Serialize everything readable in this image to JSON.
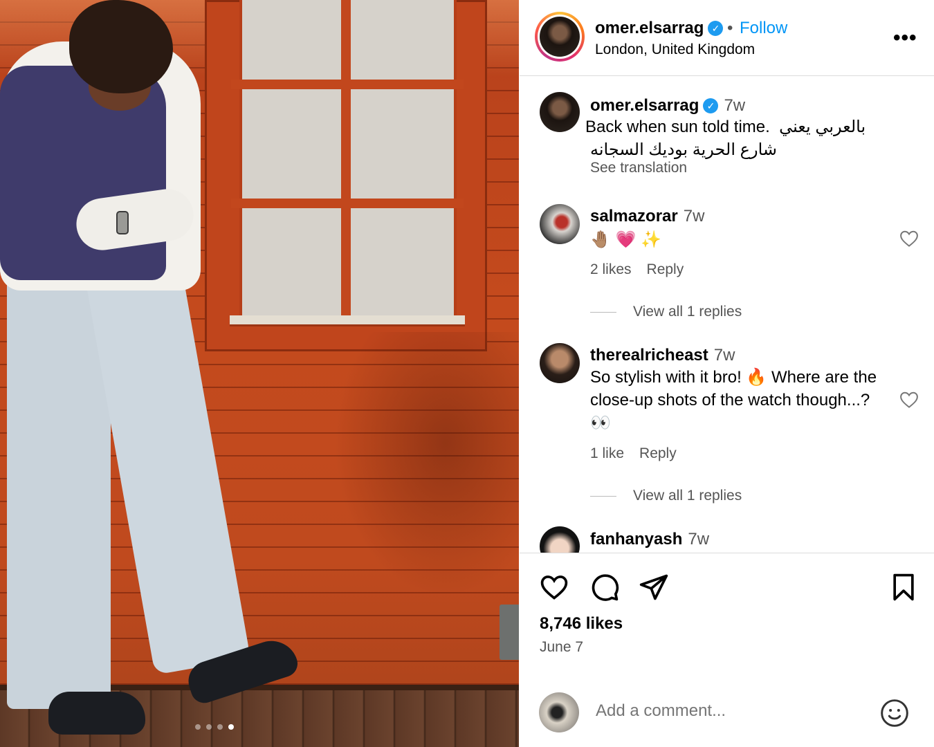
{
  "header": {
    "username": "omer.elsarrag",
    "verified_mark": "✓",
    "separator": "•",
    "follow_label": "Follow",
    "location": "London, United Kingdom",
    "more_label": "•••"
  },
  "caption": {
    "username": "omer.elsarrag",
    "time": "7w",
    "line1_en": "Back when sun told time.",
    "line1_ar": "بالعربي يعني",
    "line2_ar": "شارع الحرية بوديك السجانه",
    "see_translation": "See translation"
  },
  "comments": [
    {
      "username": "salmazorar",
      "time": "7w",
      "text": "🤚🏽 💗 ✨",
      "likes": "2 likes",
      "reply": "Reply",
      "view_replies": "View all 1 replies"
    },
    {
      "username": "therealricheast",
      "time": "7w",
      "text": "So stylish with it bro! 🔥 Where are the close-up shots of the watch though...? 👀",
      "likes": "1 like",
      "reply": "Reply",
      "view_replies": "View all 1 replies"
    },
    {
      "username": "fanhanyash",
      "time": "7w"
    }
  ],
  "actions": {
    "like_icon": "heart-icon",
    "comment_icon": "comment-icon",
    "share_icon": "send-icon",
    "save_icon": "bookmark-icon",
    "likes_count": "8,746 likes",
    "date": "June 7"
  },
  "add_comment": {
    "placeholder": "Add a comment...",
    "emoji_icon": "smiley-icon"
  },
  "carousel": {
    "slide_count": 4,
    "active_index": 3
  },
  "colors": {
    "accent": "#0095f6",
    "verified": "#1d9bf0",
    "muted": "#555555",
    "divider": "#dbdbdb"
  }
}
